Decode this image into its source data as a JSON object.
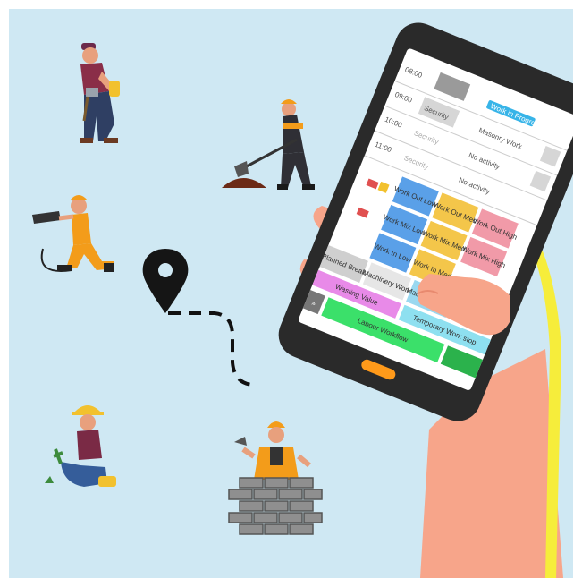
{
  "phone": {
    "rows": [
      {
        "time": "08:00",
        "field": "",
        "tag": "Work in Progress"
      },
      {
        "time": "09:00",
        "field": "Security",
        "tag": "Masonry Work"
      },
      {
        "time": "10:00",
        "field": "Security",
        "tag": "No activity"
      },
      {
        "time": "11:00",
        "field": "Security",
        "tag": "No activity"
      }
    ],
    "grid": [
      {
        "label": "Work Out Low"
      },
      {
        "label": "Work Out Med"
      },
      {
        "label": "Work Out High"
      },
      {
        "label": "Work Mix Low"
      },
      {
        "label": "Work Mix Med"
      },
      {
        "label": "Work Mix High"
      },
      {
        "label": "Work In Low"
      },
      {
        "label": "Work In Med"
      },
      {
        "label": "Planned Break"
      },
      {
        "label": "Machinery Work"
      },
      {
        "label": "Machine Moves"
      }
    ],
    "bottom": {
      "workstatus": "Wasting Value",
      "temporary": "Temporary Work stop",
      "labour": "Labour Workflow",
      "collapse": "»"
    }
  },
  "icons": {
    "pin": "location-pin-icon",
    "walker": "worker-carrying-tool-icon",
    "digger": "worker-digging-icon",
    "driller": "worker-drilling-icon",
    "gardener": "worker-planting-icon",
    "bricklayer": "worker-bricklaying-icon"
  }
}
